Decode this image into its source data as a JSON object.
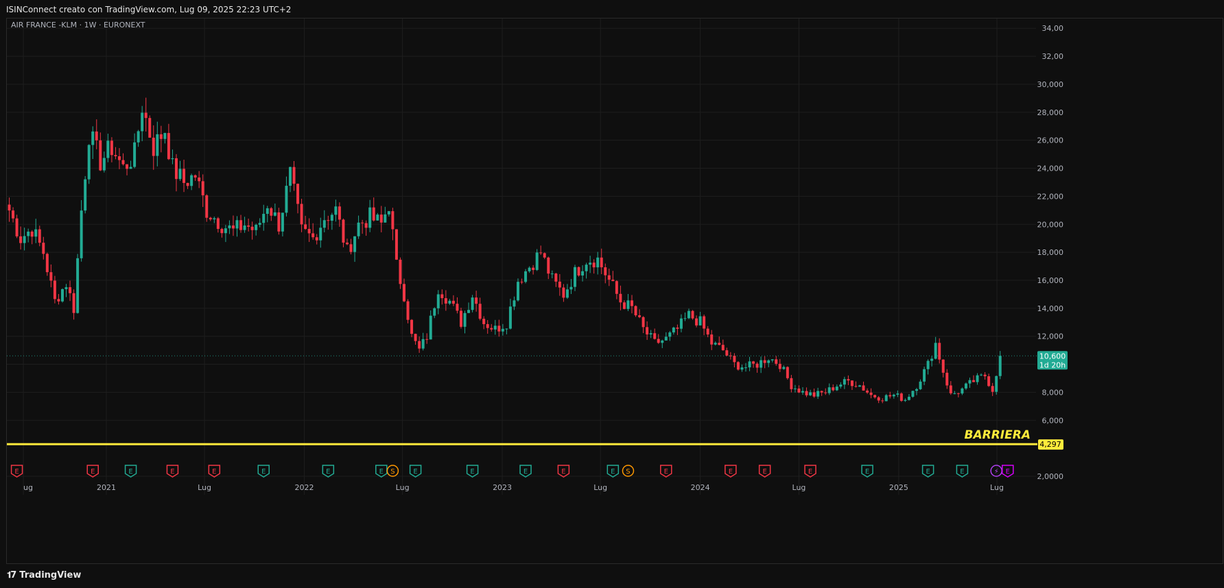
{
  "header": {
    "attribution": "ISINConnect creato con TradingView.com, Lug 09, 2025 22:23 UTC+2"
  },
  "footer": {
    "logo_text": "TradingView"
  },
  "colors": {
    "up": "#22ab94",
    "down": "#f23645",
    "barrier": "#ffeb3b",
    "background": "#0f0f0f",
    "grid": "#1e1e1e"
  },
  "chart_data": {
    "type": "candlestick",
    "title": "AIR FRANCE -KLM · 1W · EURONEXT",
    "ylim": [
      2,
      35
    ],
    "y_ticks": [
      "2,0000",
      "6,000",
      "8,000",
      "10,000",
      "12,000",
      "14,000",
      "16,000",
      "18,000",
      "20,000",
      "22,000",
      "24,000",
      "26,000",
      "28,000",
      "30,000",
      "32,00",
      "34,00"
    ],
    "y_tick_values": [
      2,
      6,
      8,
      10,
      12,
      14,
      16,
      18,
      20,
      22,
      24,
      26,
      28,
      30,
      32,
      34
    ],
    "x_labels": [
      "ug",
      "2021",
      "Lug",
      "2022",
      "Lug",
      "2023",
      "Lug",
      "2024",
      "Lug",
      "2025",
      "Lug"
    ],
    "x_label_positions": [
      "2020-08",
      "2021-01",
      "2021-07",
      "2022-01",
      "2022-07",
      "2023-01",
      "2023-07",
      "2024-01",
      "2024-07",
      "2025-01",
      "2025-07"
    ],
    "x_range": [
      "2020-07-01",
      "2025-09-01"
    ],
    "last_price": {
      "value": 10.6,
      "label": "10,600",
      "countdown": "1d 20h"
    },
    "barrier": {
      "value": 4.297,
      "label": "4,297",
      "name": "BARRIERA"
    },
    "anchors": [
      [
        "2020-07-06",
        21
      ],
      [
        "2020-07-27",
        19
      ],
      [
        "2020-08-17",
        19.7
      ],
      [
        "2020-09-07",
        18
      ],
      [
        "2020-09-28",
        14.5
      ],
      [
        "2020-10-19",
        15.8
      ],
      [
        "2020-11-02",
        14
      ],
      [
        "2020-11-16",
        21
      ],
      [
        "2020-11-30",
        26.5
      ],
      [
        "2020-12-21",
        24.5
      ],
      [
        "2021-01-11",
        25.5
      ],
      [
        "2021-02-01",
        24
      ],
      [
        "2021-02-22",
        25
      ],
      [
        "2021-03-08",
        28.5
      ],
      [
        "2021-03-29",
        25.5
      ],
      [
        "2021-04-19",
        26.8
      ],
      [
        "2021-05-03",
        24
      ],
      [
        "2021-05-24",
        23
      ],
      [
        "2021-06-14",
        23.5
      ],
      [
        "2021-07-05",
        21
      ],
      [
        "2021-08-02",
        20
      ],
      [
        "2021-08-23",
        19.5
      ],
      [
        "2021-09-13",
        20
      ],
      [
        "2021-10-04",
        19.5
      ],
      [
        "2021-10-25",
        21.5
      ],
      [
        "2021-11-15",
        20
      ],
      [
        "2021-12-06",
        23.5
      ],
      [
        "2021-12-27",
        19.5
      ],
      [
        "2022-01-17",
        19
      ],
      [
        "2022-02-07",
        20.5
      ],
      [
        "2022-02-28",
        21
      ],
      [
        "2022-03-21",
        18
      ],
      [
        "2022-04-11",
        20
      ],
      [
        "2022-05-02",
        20.5
      ],
      [
        "2022-05-23",
        20
      ],
      [
        "2022-06-06",
        21.5
      ],
      [
        "2022-06-20",
        17
      ],
      [
        "2022-07-04",
        15
      ],
      [
        "2022-07-18",
        12
      ],
      [
        "2022-08-01",
        11
      ],
      [
        "2022-08-15",
        12
      ],
      [
        "2022-09-05",
        15.5
      ],
      [
        "2022-09-26",
        14.5
      ],
      [
        "2022-10-17",
        13
      ],
      [
        "2022-11-07",
        15
      ],
      [
        "2022-11-28",
        13
      ],
      [
        "2022-12-19",
        12.5
      ],
      [
        "2023-01-09",
        13
      ],
      [
        "2023-01-30",
        16
      ],
      [
        "2023-02-20",
        17
      ],
      [
        "2023-03-13",
        18
      ],
      [
        "2023-04-03",
        16
      ],
      [
        "2023-04-24",
        15
      ],
      [
        "2023-05-15",
        16.5
      ],
      [
        "2023-06-05",
        17.5
      ],
      [
        "2023-06-26",
        17.5
      ],
      [
        "2023-07-17",
        16
      ],
      [
        "2023-08-07",
        14.5
      ],
      [
        "2023-08-28",
        14
      ],
      [
        "2023-09-18",
        12.5
      ],
      [
        "2023-10-09",
        11.5
      ],
      [
        "2023-10-30",
        11.8
      ],
      [
        "2023-11-20",
        12.5
      ],
      [
        "2023-12-11",
        13.5
      ],
      [
        "2024-01-01",
        13
      ],
      [
        "2024-01-22",
        11.5
      ],
      [
        "2024-02-12",
        11
      ],
      [
        "2024-03-04",
        10
      ],
      [
        "2024-03-25",
        9.8
      ],
      [
        "2024-04-15",
        10
      ],
      [
        "2024-05-06",
        10.5
      ],
      [
        "2024-05-27",
        10
      ],
      [
        "2024-06-17",
        8.5
      ],
      [
        "2024-07-08",
        8
      ],
      [
        "2024-07-29",
        7.8
      ],
      [
        "2024-08-19",
        8
      ],
      [
        "2024-09-09",
        8.5
      ],
      [
        "2024-09-30",
        8.8
      ],
      [
        "2024-10-21",
        8.5
      ],
      [
        "2024-11-11",
        7.8
      ],
      [
        "2024-12-02",
        7.6
      ],
      [
        "2024-12-23",
        7.8
      ],
      [
        "2025-01-13",
        7.5
      ],
      [
        "2025-02-03",
        8.5
      ],
      [
        "2025-02-24",
        10
      ],
      [
        "2025-03-10",
        11.5
      ],
      [
        "2025-03-24",
        9.5
      ],
      [
        "2025-04-07",
        7.8
      ],
      [
        "2025-04-28",
        8.2
      ],
      [
        "2025-05-19",
        8.8
      ],
      [
        "2025-06-09",
        9.2
      ],
      [
        "2025-06-23",
        8.2
      ],
      [
        "2025-07-07",
        10.6
      ]
    ],
    "events": [
      {
        "date": "2020-07-20",
        "kind": "E",
        "color": "down"
      },
      {
        "date": "2020-12-07",
        "kind": "E",
        "color": "down"
      },
      {
        "date": "2021-02-15",
        "kind": "E",
        "color": "up"
      },
      {
        "date": "2021-05-03",
        "kind": "E",
        "color": "down"
      },
      {
        "date": "2021-07-19",
        "kind": "E",
        "color": "down"
      },
      {
        "date": "2021-10-18",
        "kind": "E",
        "color": "up"
      },
      {
        "date": "2022-02-14",
        "kind": "E",
        "color": "up"
      },
      {
        "date": "2022-05-23",
        "kind": "E",
        "color": "up"
      },
      {
        "date": "2022-06-13",
        "kind": "S",
        "color": "orange"
      },
      {
        "date": "2022-07-25",
        "kind": "E",
        "color": "up"
      },
      {
        "date": "2022-11-07",
        "kind": "E",
        "color": "up"
      },
      {
        "date": "2023-02-13",
        "kind": "E",
        "color": "up"
      },
      {
        "date": "2023-04-24",
        "kind": "E",
        "color": "down"
      },
      {
        "date": "2023-07-24",
        "kind": "E",
        "color": "up"
      },
      {
        "date": "2023-08-21",
        "kind": "S",
        "color": "orange"
      },
      {
        "date": "2023-10-30",
        "kind": "E",
        "color": "down"
      },
      {
        "date": "2024-02-26",
        "kind": "E",
        "color": "down"
      },
      {
        "date": "2024-04-29",
        "kind": "E",
        "color": "down"
      },
      {
        "date": "2024-07-22",
        "kind": "E",
        "color": "down"
      },
      {
        "date": "2024-11-04",
        "kind": "E",
        "color": "up"
      },
      {
        "date": "2025-02-24",
        "kind": "E",
        "color": "up"
      },
      {
        "date": "2025-04-28",
        "kind": "E",
        "color": "up"
      },
      {
        "date": "2025-06-30",
        "kind": "⚡",
        "color": "purple"
      },
      {
        "date": "2025-07-21",
        "kind": "E",
        "color": "magenta"
      }
    ]
  }
}
